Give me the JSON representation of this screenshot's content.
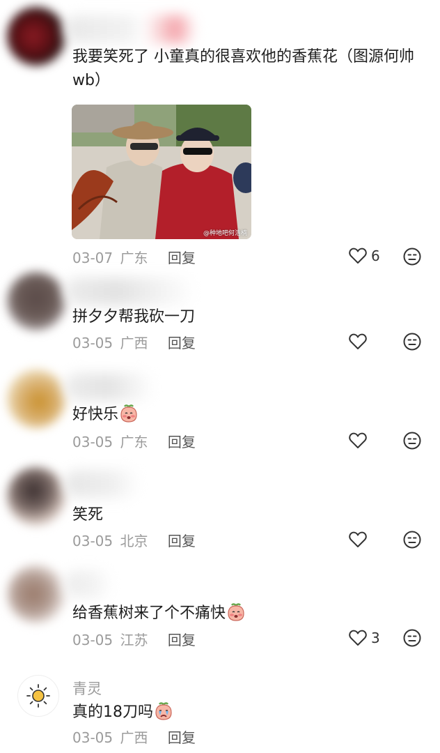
{
  "comments": [
    {
      "text": "我要笑死了 小童真的很喜欢他的香蕉花（图源何帅wb）",
      "date": "03-07",
      "location": "广东",
      "reply": "回复",
      "likes": "6",
      "image_watermark": "@种地吧何浩楠",
      "avatar_color": "#8c1c24"
    },
    {
      "text": "拼夕夕帮我砍一刀",
      "date": "03-05",
      "location": "广西",
      "reply": "回复",
      "likes": "",
      "avatar_color": "#5a4a48"
    },
    {
      "text": "好快乐",
      "date": "03-05",
      "location": "广东",
      "reply": "回复",
      "likes": "",
      "emoji": "blushing-peach-emoji",
      "avatar_color": "#c9902c"
    },
    {
      "text": "笑死",
      "date": "03-05",
      "location": "北京",
      "reply": "回复",
      "likes": "",
      "avatar_color": "#3a2e2e"
    },
    {
      "text": "给香蕉树来了个不痛快",
      "date": "03-05",
      "location": "江苏",
      "reply": "回复",
      "likes": "3",
      "emoji": "blushing-peach-emoji",
      "avatar_color": "#9a7a6a"
    },
    {
      "name": "青灵",
      "text": "真的18刀吗",
      "date": "03-05",
      "location": "广西",
      "reply": "回复",
      "likes": "",
      "emoji": "crying-peach-emoji",
      "avatar_icon": "sun-icon"
    }
  ],
  "icons": {
    "like": "heart-outline-icon",
    "dislike": "neutral-face-icon"
  }
}
